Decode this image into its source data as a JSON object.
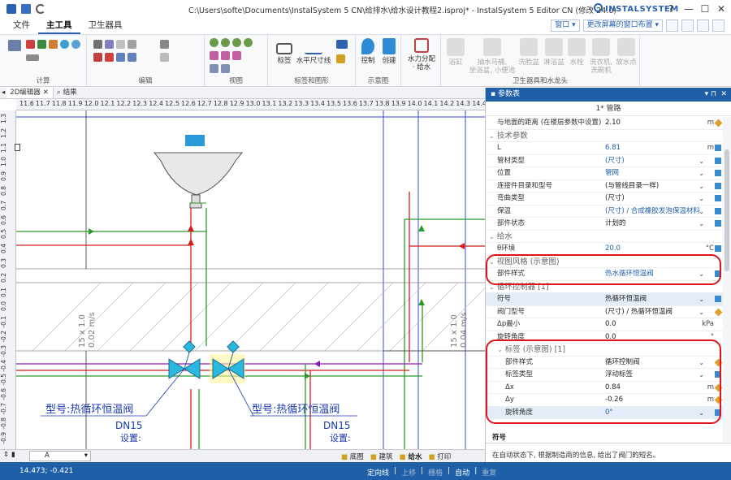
{
  "window": {
    "title": "C:\\Users\\softe\\Documents\\InstalSystem 5 CN\\给排水\\给水设计教程2.isproj* - InstalSystem 5 Editor CN (修改 24.0)",
    "brand": "INSTALSYSTEM"
  },
  "ribbon": {
    "tabs": [
      "文件",
      "主工具",
      "卫生器具"
    ],
    "active_tab": "主工具",
    "window_dropdown": "窗口",
    "layout_dropdown": "更改屏幕的窗口布置",
    "groups": {
      "calc": "计算",
      "edit": "编辑",
      "view": "视图",
      "labels": "标签和图形",
      "schematic": "示意图",
      "fixtures": "卫生器具和水龙头"
    },
    "buttons": {
      "label": "标签",
      "hdim": "水平尺寸线",
      "control": "控制",
      "create": "创建",
      "hydraulic": "水力分配",
      "hydraulic2": "· 给水",
      "bathtub": "浴缸",
      "flush_toilet": "抽水马桶,",
      "flush_toilet2": "坐浴盆, 小便池",
      "washbasin": "洗脸盆",
      "shower": "淋浴盆",
      "faucet": "水栓",
      "washer": "洗衣机,",
      "washer2": "洗碗机",
      "drain": "放水点"
    }
  },
  "doc_tabs": [
    "2D编辑器",
    "结果"
  ],
  "ruler": {
    "h": [
      "11.6",
      "11.7",
      "11.8",
      "11.9",
      "12.0",
      "12.1",
      "12.2",
      "12.3",
      "12.4",
      "12.5",
      "12.6",
      "12.7",
      "12.8",
      "12.9",
      "13.0",
      "13.1",
      "13.2",
      "13.3",
      "13.4",
      "13.5",
      "13.6",
      "13.7",
      "13.8",
      "13.9",
      "14.0",
      "14.1",
      "14.2",
      "14.3",
      "14.4"
    ],
    "v": [
      "1.3",
      "1.2",
      "1.1",
      "1.0",
      "0.9",
      "0.8",
      "0.7",
      "0.6",
      "0.5",
      "0.4",
      "0.3",
      "0.2",
      "0.1",
      "0.0",
      "-0.1",
      "-0.2",
      "-0.3",
      "-0.4",
      "-0.5",
      "-0.6",
      "-0.7",
      "-0.8",
      "-0.9"
    ]
  },
  "drawing": {
    "pipe_label_left_1": "15 x 1.0",
    "pipe_label_left_2": "0.02 m/s",
    "pipe_label_right_1": "15 x 1.0",
    "pipe_label_right_2": "0.04 m/s",
    "valve_label": "型号:热循环恒温阀",
    "dn": "DN15",
    "setting": "设置:"
  },
  "canvas_status": {
    "layer": "A",
    "views": [
      "底图",
      "建筑",
      "给水",
      "打印"
    ]
  },
  "statusbar": {
    "coords": "14.473; -0.421",
    "modes": [
      "定向线",
      "上移",
      "栅格",
      "自动",
      "重复"
    ],
    "modes_active": [
      true,
      false,
      false,
      true,
      false
    ]
  },
  "panel": {
    "header": "参数表",
    "title": "1* 管路",
    "rows": [
      {
        "k": "与地面的距离 (在楼层参数中设置)",
        "v": "2.10",
        "u": "m",
        "icon": "edit"
      },
      {
        "section": "技术参数"
      },
      {
        "k": "L",
        "v": "6.81",
        "u": "m",
        "blue": true,
        "icon": "calc"
      },
      {
        "k": "管材类型",
        "v": "(尺寸)",
        "blue": true,
        "chev": true,
        "icon": "calc"
      },
      {
        "k": "位置",
        "v": "管网",
        "blue": true,
        "chev": true,
        "icon": "calc"
      },
      {
        "k": "连接件目录和型号",
        "v": "(与管线目录一样)",
        "chev": true,
        "icon": "calc"
      },
      {
        "k": "弯曲类型",
        "v": "(尺寸)",
        "chev": true,
        "icon": "calc"
      },
      {
        "k": "保温",
        "v": "(尺寸) / 合成橡胶发泡保温材料",
        "blue": true,
        "chev": true,
        "icon": "calc"
      },
      {
        "k": "部件状态",
        "v": "计划的",
        "chev": true,
        "icon": "calc"
      },
      {
        "section": "给水"
      },
      {
        "k": "θ环境",
        "v": "20.0",
        "u": "°C",
        "blue": true,
        "icon": "calc"
      },
      {
        "section": "视图风格 (示意图)"
      },
      {
        "k": "部件样式",
        "v": "热水循环恒温阀",
        "blue": true,
        "chev": true,
        "icon": "calc"
      },
      {
        "section": "循环控制器 [1]"
      },
      {
        "k": "符号",
        "v": "热循环恒温阀",
        "hl": true,
        "chev": true,
        "icon": "calc"
      },
      {
        "k": "阀门型号",
        "v": "(尺寸) / 热循环恒温阀",
        "chev": true,
        "icon": "edit"
      },
      {
        "k": "Δp最小",
        "v": "0.0",
        "u": "kPa"
      },
      {
        "k": "旋转角度",
        "v": "0.0",
        "u": "°"
      },
      {
        "section": "标签 (示意图) [1]",
        "sub": true
      },
      {
        "k": "部件样式",
        "v": "循环控制阀",
        "chev": true,
        "icon": "edit",
        "sub": true
      },
      {
        "k": "标签类型",
        "v": "浮动标签",
        "chev": true,
        "icon": "calc",
        "sub": true
      },
      {
        "k": "Δx",
        "v": "0.84",
        "u": "m",
        "icon": "edit",
        "sub": true
      },
      {
        "k": "Δy",
        "v": "-0.26",
        "u": "m",
        "icon": "edit",
        "sub": true
      },
      {
        "k": "旋转角度",
        "v": "0°",
        "blue": true,
        "chev": true,
        "icon": "calc",
        "sub": true,
        "hl": true
      }
    ],
    "help_title": "符号",
    "help_text": "在自动状态下, 根据制造商的信息, 给出了阀门的短名。"
  }
}
